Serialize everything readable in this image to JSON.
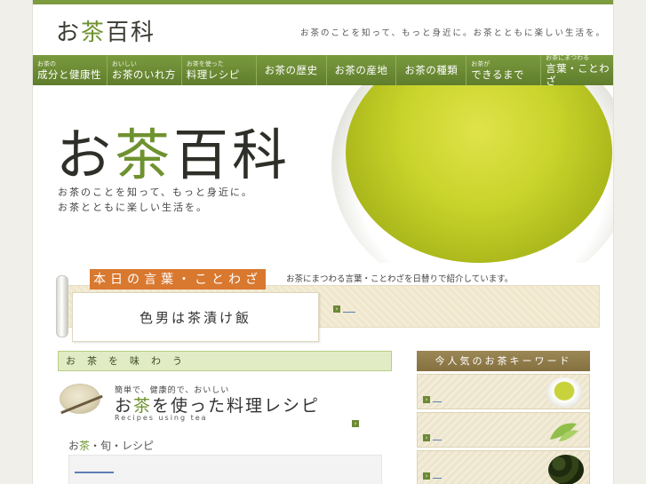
{
  "site": {
    "logo_pre": "お",
    "logo_accent": "茶",
    "logo_post": "百科",
    "tagline": "お茶のことを知って、もっと身近に。お茶とともに楽しい生活を。"
  },
  "nav": {
    "items": [
      {
        "small": "お茶の",
        "label": "成分と健康性"
      },
      {
        "small": "おいしい",
        "label": "お茶のいれ方"
      },
      {
        "small": "お茶を使った",
        "label": "料理レシピ"
      },
      {
        "small": "",
        "label": "お茶の歴史"
      },
      {
        "small": "",
        "label": "お茶の産地"
      },
      {
        "small": "",
        "label": "お茶の種類"
      },
      {
        "small": "お茶が",
        "label": "できるまで"
      },
      {
        "small": "お茶にまつわる",
        "label": "言葉・ことわざ"
      }
    ]
  },
  "hero": {
    "title_pre": "お",
    "title_accent": "茶",
    "title_post": "百科",
    "sub_line1": "お茶のことを知って、もっと身近に。",
    "sub_line2": "お茶とともに楽しい生活を。"
  },
  "proverb": {
    "heading": "本日の言葉・ことわざ",
    "note": "お茶にまつわる言葉・ことわざを日替りで紹介しています。",
    "text": "色男は茶漬け飯"
  },
  "left": {
    "section_title": "お茶を味わう",
    "recipe_small": "簡単で、健康的で、おいしい",
    "recipe_big_pre": "お",
    "recipe_big_accent": "茶",
    "recipe_big_post": "を使った料理レシピ",
    "recipe_en": "Recipes using tea",
    "shun_pre": "お",
    "shun_accent": "茶",
    "shun_post": "・旬・レシピ"
  },
  "right": {
    "keywords_title": "今人気のお茶キーワード"
  },
  "colors": {
    "brand_green": "#6f9230",
    "nav_green": "#6a8934",
    "proverb_orange": "#d9782f",
    "keyword_brown": "#8f7a48"
  }
}
